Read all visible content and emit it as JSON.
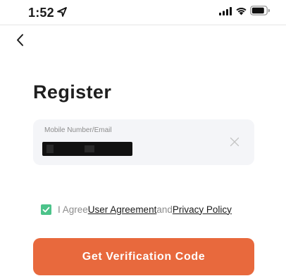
{
  "status_bar": {
    "time": "1:52",
    "icons": [
      "location-arrow-icon",
      "cellular-signal-icon",
      "wifi-icon",
      "battery-icon"
    ]
  },
  "nav": {
    "back_icon": "chevron-left-icon"
  },
  "page": {
    "title": "Register"
  },
  "form": {
    "field_label": "Mobile Number/Email",
    "field_value": "",
    "field_value_redacted": true,
    "clear_icon": "close-icon"
  },
  "agreement": {
    "checked": true,
    "prefix": "I Agree",
    "user_agreement_link": "User Agreement",
    "connector": "and",
    "privacy_policy_link": "Privacy Policy"
  },
  "actions": {
    "primary_label": "Get Verification Code"
  },
  "colors": {
    "primary": "#e8693d",
    "checkbox": "#4cc38a",
    "field_background": "#f4f5f8",
    "muted_text": "#8c8c8c"
  }
}
